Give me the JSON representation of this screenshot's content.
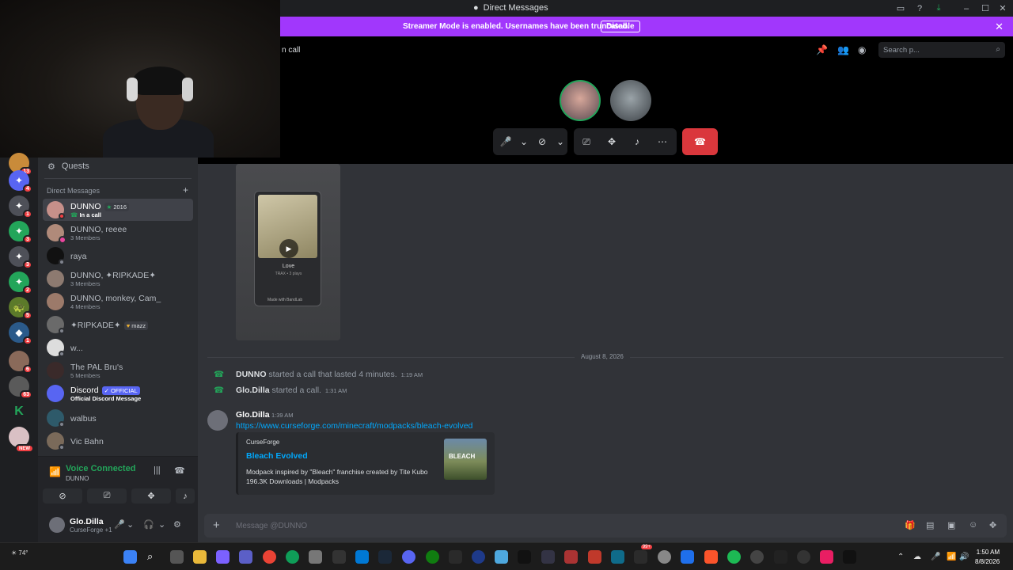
{
  "window": {
    "title": "Direct Messages"
  },
  "banner": {
    "text": "Streamer Mode is enabled. Usernames have been truncated.",
    "button_label": "Disable"
  },
  "rail": {
    "badges": [
      "13",
      "4",
      "1",
      "3",
      "3",
      "2",
      "5",
      "1",
      "6",
      "63",
      "NEW"
    ]
  },
  "sidebar": {
    "quests_label": "Quests",
    "dm_header": "Direct Messages",
    "items": [
      {
        "name": "DUNNO",
        "tag": "2016",
        "sub": "In a call"
      },
      {
        "name": "DUNNO, reeee",
        "sub": "3 Members"
      },
      {
        "name": "raya"
      },
      {
        "name": "DUNNO, ✦RIPKADE✦",
        "sub": "3 Members"
      },
      {
        "name": "DUNNO, monkey, Cam_",
        "sub": "4 Members"
      },
      {
        "name": "✦RIPKADE✦",
        "tag": "mazz"
      },
      {
        "name": "w..."
      },
      {
        "name": "The PAL Bru's",
        "sub": "5 Members"
      },
      {
        "name": "Discord",
        "tag": "OFFICIAL",
        "sub": "Official Discord Message"
      },
      {
        "name": "walbus"
      },
      {
        "name": "Vic Bahn"
      }
    ]
  },
  "voice": {
    "status": "Voice Connected",
    "channel": "DUNNO"
  },
  "user": {
    "name": "Glo.Dilla",
    "status": "CurseForge +1"
  },
  "call": {
    "header": "n call",
    "search_placeholder": "Search p..."
  },
  "chat": {
    "video_title": "Love",
    "video_sub": "TRAX • 3 plays",
    "video_footer": "Made with BandLab",
    "date_separator": "August 8, 2026",
    "system_messages": [
      {
        "user": "DUNNO",
        "text": "started a call that lasted 4 minutes.",
        "time": "1:19 AM"
      },
      {
        "user": "Glo.Dilla",
        "text": "started a call.",
        "time": "1:31 AM"
      }
    ],
    "message": {
      "author": "Glo.Dilla",
      "time": "1:39 AM",
      "link": "https://www.curseforge.com/minecraft/modpacks/bleach-evolved",
      "embed": {
        "provider": "CurseForge",
        "title": "Bleach Evolved",
        "description": "Modpack inspired by \"Bleach\" franchise created by Tite Kubo",
        "meta": "196.3K Downloads | Modpacks",
        "image_text": "BLEACH"
      }
    }
  },
  "composer": {
    "placeholder": "Message @DUNNO"
  },
  "taskbar": {
    "weather": "74°",
    "time": "1:50 AM",
    "date": "8/8/2026",
    "badge_99": "99+"
  },
  "colors": {
    "accent": "#5865f2",
    "banner": "#a137fc",
    "online": "#23a55a",
    "hangup": "#da373c",
    "link": "#00a8fc"
  }
}
